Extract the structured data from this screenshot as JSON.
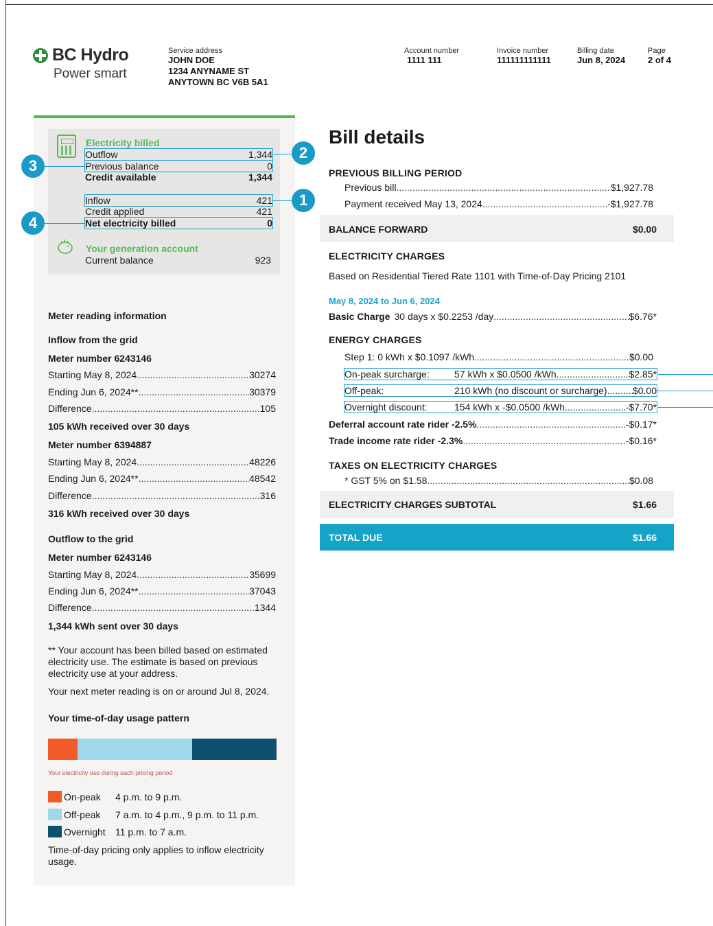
{
  "header": {
    "brand": "BC Hydro",
    "tagline": "Power smart",
    "service_address_label": "Service address",
    "service_name": "JOHN DOE",
    "service_street": "1234 ANYNAME ST",
    "service_city": "ANYTOWN BC  V6B 5A1",
    "account_label": "Account number",
    "account_value": "1111 111",
    "invoice_label": "Invoice number",
    "invoice_value": "111111111111",
    "billing_date_label": "Billing date",
    "billing_date_value": "Jun 8, 2024",
    "page_label": "Page",
    "page_value": "2 of 4"
  },
  "summary": {
    "title": "Electricity billed",
    "outflow_label": "Outflow",
    "outflow_value": "1,344",
    "prev_label": "Previous balance",
    "prev_value": "0",
    "credit_avail_label": "Credit available",
    "credit_avail_value": "1,344",
    "inflow_label": "Inflow",
    "inflow_value": "421",
    "credit_applied_label": "Credit applied",
    "credit_applied_value": "421",
    "net_label": "Net electricity billed",
    "net_value": "0",
    "gen_title": "Your generation account",
    "gen_balance_label": "Current balance",
    "gen_balance_value": "923",
    "callouts": [
      "1",
      "2",
      "3",
      "4"
    ]
  },
  "meter": {
    "title": "Meter reading information",
    "inflow_title": "Inflow from the grid",
    "m1_title": "Meter number 6243146",
    "m1_start_label": "Starting May 8, 2024",
    "m1_start": "30274",
    "m1_end_label": "Ending Jun 6, 2024**",
    "m1_end": "30379",
    "m1_diff_label": "Difference",
    "m1_diff": "105",
    "m1_summary": "105 kWh received over 30 days",
    "m2_title": "Meter number 6394887",
    "m2_start_label": "Starting May 8, 2024",
    "m2_start": "48226",
    "m2_end_label": "Ending Jun 6, 2024**",
    "m2_end": "48542",
    "m2_diff_label": "Difference",
    "m2_diff": "316",
    "m2_summary": "316 kWh received over 30 days",
    "outflow_title": "Outflow to the grid",
    "m3_title": "Meter number 6243146",
    "m3_start_label": "Starting May 8, 2024",
    "m3_start": "35699",
    "m3_end_label": "Ending Jun 6, 2024**",
    "m3_end": "37043",
    "m3_diff_label": "Difference",
    "m3_diff": "1344",
    "m3_summary": "1,344 kWh sent over 30 days",
    "note": "** Your account has been billed based on estimated electricity use. The estimate is based on previous electricity use at your address.",
    "next_reading": "Your next meter reading is on or around Jul 8, 2024."
  },
  "tod": {
    "title": "Your time-of-day usage pattern",
    "bar_caption": "Your electricity use during each pricing period",
    "shares": {
      "on_peak": 0.13,
      "off_peak": 0.5,
      "overnight": 0.37
    },
    "colors": {
      "on_peak": "#f15a29",
      "off_peak": "#9fd8ea",
      "overnight": "#0f4f6e"
    },
    "legend": [
      {
        "name": "On-peak",
        "hours": "4 p.m. to 9 p.m."
      },
      {
        "name": "Off-peak",
        "hours": "7 a.m. to 4 p.m., 9 p.m. to 11 p.m."
      },
      {
        "name": "Overnight",
        "hours": "11 p.m. to 7 a.m."
      }
    ],
    "footnote": "Time-of-day pricing only applies to inflow electricity usage."
  },
  "bill": {
    "title": "Bill details",
    "prev_period_title": "PREVIOUS BILLING PERIOD",
    "prev_bill_label": "Previous bill",
    "prev_bill_value": "$1,927.78",
    "payment_label": "Payment received May 13, 2024",
    "payment_value": "-$1,927.78",
    "balance_forward_label": "BALANCE FORWARD",
    "balance_forward_value": "$0.00",
    "elec_title": "ELECTRICITY CHARGES",
    "rate_desc": "Based on Residential Tiered Rate 1101 with Time-of-Day Pricing 2101",
    "period": "May 8, 2024 to Jun 6, 2024",
    "basic_label": "Basic Charge",
    "basic_desc": "30 days x $0.2253 /day",
    "basic_value": "$6.76*",
    "energy_title": "ENERGY CHARGES",
    "step1_label": "Step 1:  0 kWh x $0.1097 /kWh",
    "step1_value": "$0.00",
    "onpeak_label": "On-peak surcharge:",
    "onpeak_desc": "57 kWh x $0.0500 /kWh",
    "onpeak_value": "$2.85*",
    "offpeak_label": "Off-peak:",
    "offpeak_desc": "210 kWh (no discount or surcharge)",
    "offpeak_value": "$0.00",
    "overnight_label": "Overnight discount:",
    "overnight_desc": "154 kWh x -$0.0500 /kWh",
    "overnight_value": "-$7.70*",
    "deferral_label": "Deferral account rate rider -2.5%",
    "deferral_value": "-$0.17*",
    "trade_label": "Trade income rate rider -2.3%",
    "trade_value": "-$0.16*",
    "taxes_title": "TAXES ON ELECTRICITY CHARGES",
    "gst_label": "* GST 5% on $1.58",
    "gst_value": "$0.08",
    "subtotal_label": "ELECTRICITY CHARGES SUBTOTAL",
    "subtotal_value": "$1.66",
    "total_label": "TOTAL DUE",
    "total_value": "$1.66"
  }
}
